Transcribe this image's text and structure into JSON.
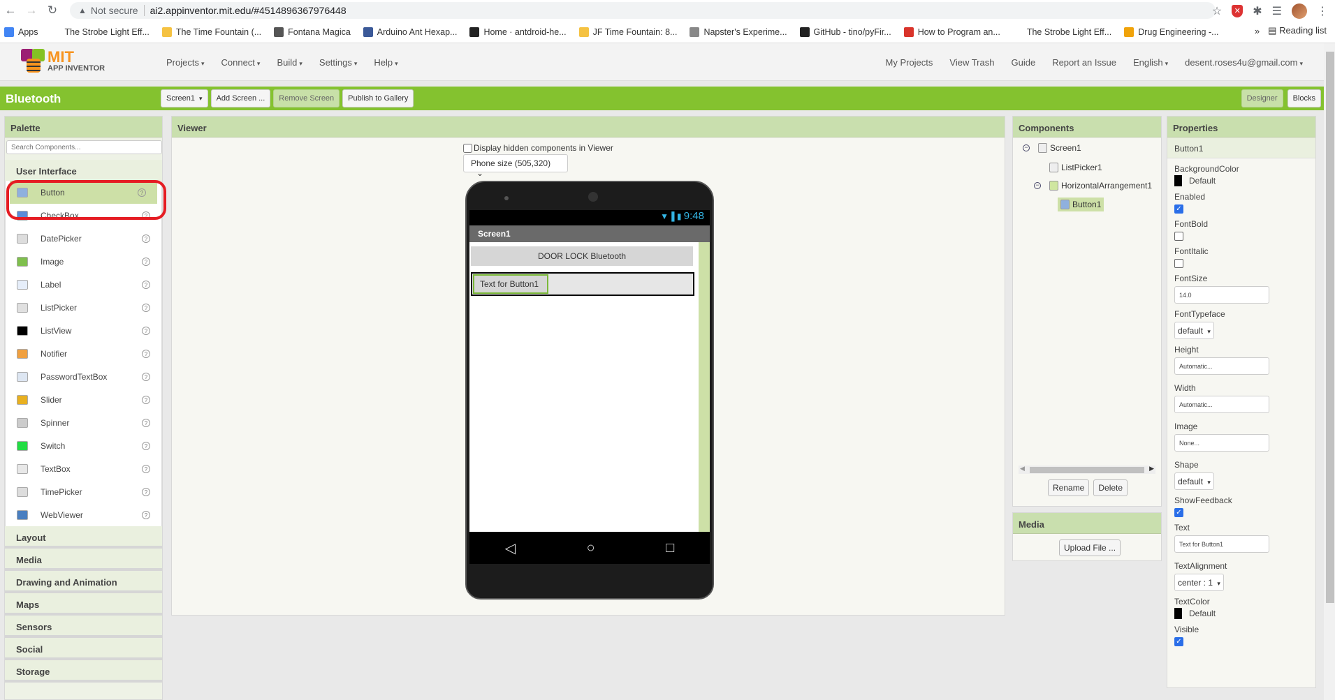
{
  "browser": {
    "not_secure": "Not secure",
    "url": "ai2.appinventor.mit.edu/#4514896367976448",
    "bookmarks": [
      {
        "label": "Apps",
        "icon": "apps-grid-icon",
        "color": "#4285f4"
      },
      {
        "label": "The Strobe Light Eff...",
        "icon": "page-icon",
        "color": "#ffffff"
      },
      {
        "label": "The Time Fountain (...",
        "icon": "instructables-icon",
        "color": "#f5c242"
      },
      {
        "label": "Fontana Magica",
        "icon": "globe-icon",
        "color": "#555555"
      },
      {
        "label": "Arduino Ant Hexap...",
        "icon": "m-icon",
        "color": "#3b5998"
      },
      {
        "label": "Home · antdroid-he...",
        "icon": "github-icon",
        "color": "#222222"
      },
      {
        "label": "JF Time Fountain: 8...",
        "icon": "instructables-icon",
        "color": "#f5c242"
      },
      {
        "label": "Napster's Experime...",
        "icon": "plant-icon",
        "color": "#888888"
      },
      {
        "label": "GitHub - tino/pyFir...",
        "icon": "github-icon",
        "color": "#222222"
      },
      {
        "label": "How to Program an...",
        "icon": "book-icon",
        "color": "#d9342b"
      },
      {
        "label": "The Strobe Light Eff...",
        "icon": "page-icon",
        "color": "#ffffff"
      },
      {
        "label": "Drug Engineering -...",
        "icon": "infinity-icon",
        "color": "#f0a30a"
      }
    ],
    "more": "»",
    "reading_list": "Reading list"
  },
  "app": {
    "logo_mit": "MIT",
    "logo_sub": "APP INVENTOR",
    "menu": [
      "Projects",
      "Connect",
      "Build",
      "Settings",
      "Help"
    ],
    "menu_right": {
      "my_projects": "My Projects",
      "view_trash": "View Trash",
      "guide": "Guide",
      "report": "Report an Issue",
      "language": "English",
      "account": "desent.roses4u@gmail.com"
    },
    "project_title": "Bluetooth",
    "toolbar": {
      "screen": "Screen1",
      "add_screen": "Add Screen ...",
      "remove_screen": "Remove Screen",
      "publish": "Publish to Gallery",
      "designer": "Designer",
      "blocks": "Blocks"
    },
    "colors": {
      "brand_green": "#84c22f",
      "panel_head": "#c9dfae",
      "selection": "#cde0a7",
      "highlight_red": "#e51c23"
    }
  },
  "palette": {
    "title": "Palette",
    "search_placeholder": "Search Components...",
    "section": "User Interface",
    "items": [
      {
        "label": "Button",
        "icon": "button-icon",
        "color": "#8fb0de"
      },
      {
        "label": "CheckBox",
        "icon": "checkbox-icon",
        "color": "#5b8cd8"
      },
      {
        "label": "DatePicker",
        "icon": "datepicker-icon",
        "color": "#dddddd"
      },
      {
        "label": "Image",
        "icon": "image-icon",
        "color": "#7fbf4d"
      },
      {
        "label": "Label",
        "icon": "label-icon",
        "color": "#e6eefa"
      },
      {
        "label": "ListPicker",
        "icon": "listpicker-icon",
        "color": "#e0e0e0"
      },
      {
        "label": "ListView",
        "icon": "listview-icon",
        "color": "#000000"
      },
      {
        "label": "Notifier",
        "icon": "notifier-icon",
        "color": "#f0a040"
      },
      {
        "label": "PasswordTextBox",
        "icon": "password-icon",
        "color": "#dde6f2"
      },
      {
        "label": "Slider",
        "icon": "slider-icon",
        "color": "#e8b020"
      },
      {
        "label": "Spinner",
        "icon": "spinner-icon",
        "color": "#cccccc"
      },
      {
        "label": "Switch",
        "icon": "switch-icon",
        "color": "#22dd44"
      },
      {
        "label": "TextBox",
        "icon": "textbox-icon",
        "color": "#e8e8e8"
      },
      {
        "label": "TimePicker",
        "icon": "timepicker-icon",
        "color": "#dddddd"
      },
      {
        "label": "WebViewer",
        "icon": "webviewer-icon",
        "color": "#4a7fc0"
      }
    ],
    "categories": [
      "Layout",
      "Media",
      "Drawing and Animation",
      "Maps",
      "Sensors",
      "Social",
      "Storage"
    ]
  },
  "viewer": {
    "title": "Viewer",
    "hidden_checkbox_label": "Display hidden components in Viewer",
    "phone_size": "Phone size (505,320)",
    "status_time": "9:48",
    "screen_title": "Screen1",
    "door_button": "DOOR LOCK Bluetooth",
    "button1_text": "Text for Button1"
  },
  "components": {
    "title": "Components",
    "tree": [
      "Screen1",
      "ListPicker1",
      "HorizontalArrangement1",
      "Button1"
    ],
    "rename": "Rename",
    "delete": "Delete"
  },
  "media": {
    "title": "Media",
    "upload": "Upload File ..."
  },
  "properties": {
    "title": "Properties",
    "component": "Button1",
    "background_color": {
      "label": "BackgroundColor",
      "value": "Default"
    },
    "enabled": {
      "label": "Enabled",
      "checked": true
    },
    "font_bold": {
      "label": "FontBold",
      "checked": false
    },
    "font_italic": {
      "label": "FontItalic",
      "checked": false
    },
    "font_size": {
      "label": "FontSize",
      "value": "14.0"
    },
    "font_typeface": {
      "label": "FontTypeface",
      "value": "default"
    },
    "height": {
      "label": "Height",
      "value": "Automatic..."
    },
    "width": {
      "label": "Width",
      "value": "Automatic..."
    },
    "image": {
      "label": "Image",
      "value": "None..."
    },
    "shape": {
      "label": "Shape",
      "value": "default"
    },
    "show_feedback": {
      "label": "ShowFeedback",
      "checked": true
    },
    "text": {
      "label": "Text",
      "value": "Text for Button1"
    },
    "text_alignment": {
      "label": "TextAlignment",
      "value": "center : 1"
    },
    "text_color": {
      "label": "TextColor",
      "value": "Default"
    },
    "visible": {
      "label": "Visible",
      "checked": true
    }
  }
}
